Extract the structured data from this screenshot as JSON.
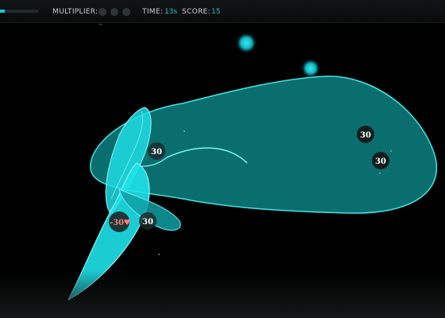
{
  "hud": {
    "multiplier_label": "MULTIPLIER:",
    "time_label": "TIME:",
    "time_value": "13s",
    "score_label": "SCORE:",
    "score_value": "15",
    "progress_fraction": 0.12
  },
  "tokens": {
    "fin_top": "30",
    "fin_bottom": "30",
    "body_upper": "30",
    "body_lower": "30",
    "penalty": "-30"
  },
  "penalty_icon": "heart-icon",
  "colors": {
    "background": "#000000",
    "accent": "#19c7d6",
    "whale_body": "#0b6e6e",
    "fin": "#22e6ec",
    "badge": "#1d2b2b",
    "penalty_text": "#ff7a7a"
  }
}
